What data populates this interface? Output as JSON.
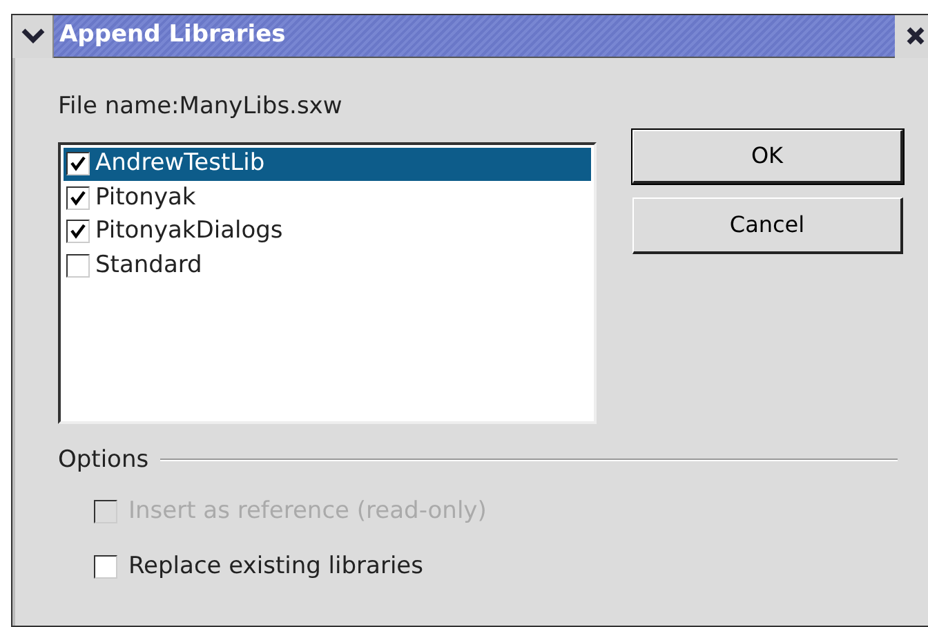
{
  "window": {
    "title": "Append Libraries"
  },
  "file_label": "File name:ManyLibs.sxw",
  "libraries": [
    {
      "name": "AndrewTestLib",
      "checked": true,
      "selected": true
    },
    {
      "name": "Pitonyak",
      "checked": true,
      "selected": false
    },
    {
      "name": "PitonyakDialogs",
      "checked": true,
      "selected": false
    },
    {
      "name": "Standard",
      "checked": false,
      "selected": false
    }
  ],
  "buttons": [
    {
      "label": "OK",
      "default": true
    },
    {
      "label": "Cancel",
      "default": false
    }
  ],
  "options": {
    "title": "Options",
    "items": [
      {
        "label": "Insert as reference (read-only)",
        "checked": false,
        "disabled": true
      },
      {
        "label": "Replace existing libraries",
        "checked": false,
        "disabled": false
      }
    ]
  }
}
